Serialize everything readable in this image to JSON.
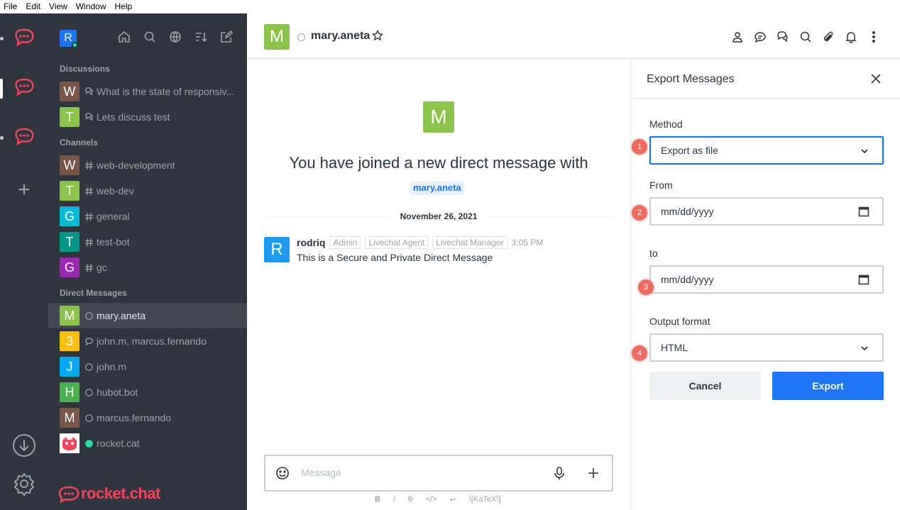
{
  "menu": [
    "File",
    "Edit",
    "View",
    "Window",
    "Help"
  ],
  "sidebar": {
    "user_initial": "R",
    "sections": {
      "discussions": "Discussions",
      "channels": "Channels",
      "direct": "Direct Messages"
    },
    "discussions": [
      {
        "initial": "W",
        "color": "#795548",
        "label": "What is the state of responsiv..."
      },
      {
        "initial": "T",
        "color": "#8bc34a",
        "label": "Lets discuss test"
      }
    ],
    "channels": [
      {
        "initial": "W",
        "color": "#795548",
        "label": "web-development"
      },
      {
        "initial": "T",
        "color": "#8bc34a",
        "label": "web-dev"
      },
      {
        "initial": "G",
        "color": "#00bcd4",
        "label": "general"
      },
      {
        "initial": "T",
        "color": "#009688",
        "label": "test-bot"
      },
      {
        "initial": "G",
        "color": "#9c27b0",
        "label": "gc"
      }
    ],
    "direct": [
      {
        "initial": "M",
        "color": "#8bc34a",
        "label": "mary.aneta",
        "status": "offline"
      },
      {
        "initial": "3",
        "color": "#ffc107",
        "label": "john.m, marcus.fernando",
        "status": "group"
      },
      {
        "initial": "J",
        "color": "#03a9f4",
        "label": "john.m",
        "status": "offline"
      },
      {
        "initial": "H",
        "color": "#4caf50",
        "label": "hubot.bot",
        "status": "offline"
      },
      {
        "initial": "M",
        "color": "#795548",
        "label": "marcus.fernando",
        "status": "offline"
      },
      {
        "initial": "",
        "color": "#f5455c",
        "label": "rocket.cat",
        "status": "online"
      }
    ],
    "brand": "rocket.chat"
  },
  "room": {
    "initial": "M",
    "name": "mary.aneta"
  },
  "chat": {
    "welcome_text": "You have joined a new direct message with",
    "welcome_mention": "mary.aneta",
    "date": "November 26, 2021",
    "message": {
      "initial": "R",
      "user": "rodriq",
      "roles": [
        "Admin",
        "Livechat Agent",
        "Livechat Manager"
      ],
      "time": "3:05 PM",
      "body": "This is a Secure and Private Direct Message"
    },
    "composer_placeholder": "Message",
    "format_bar": [
      "B",
      "i",
      "S",
      "</>",
      "↵",
      "\\[KaTeX\\]"
    ]
  },
  "export": {
    "title": "Export Messages",
    "method_label": "Method",
    "method_value": "Export as file",
    "from_label": "From",
    "from_value": "mm/dd/yyyy",
    "to_label": "to",
    "to_value": "mm/dd/yyyy",
    "format_label": "Output format",
    "format_value": "HTML",
    "cancel": "Cancel",
    "submit": "Export",
    "badges": [
      "1",
      "2",
      "3",
      "4"
    ]
  },
  "colors": {
    "accent": "#1d74f5",
    "brand": "#f5455c",
    "sidebar_bg": "#2f343d",
    "badge": "#ec6a5e"
  }
}
